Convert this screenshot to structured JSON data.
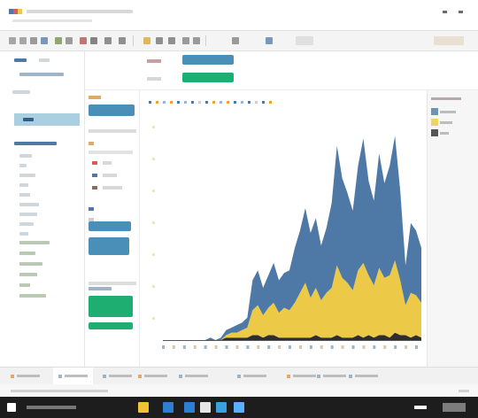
{
  "window": {
    "title": "",
    "accent": "#4e79a7"
  },
  "toolbar": {
    "buttons": [
      {
        "icon": "back-icon",
        "color": "#8c8c8c"
      },
      {
        "icon": "forward-icon",
        "color": "#8c8c8c"
      },
      {
        "icon": "save-icon",
        "color": "#7c7c7c"
      },
      {
        "icon": "new-datasource-icon",
        "color": "#4e79a7"
      },
      {
        "icon": "new-sheet-icon",
        "color": "#6b8e3f"
      },
      {
        "icon": "duplicate-icon",
        "color": "#7f7f7f"
      },
      {
        "icon": "clear-icon",
        "color": "#b04c4c"
      },
      {
        "icon": "swap-icon",
        "color": "#5f5f5f"
      },
      {
        "icon": "sort-asc-icon",
        "color": "#6d6d6d"
      },
      {
        "icon": "sort-desc-icon",
        "color": "#6d6d6d"
      },
      {
        "icon": "highlight-icon",
        "color": "#d8a32b"
      },
      {
        "icon": "group-icon",
        "color": "#6d6d6d"
      },
      {
        "icon": "label-icon",
        "color": "#6d6d6d"
      },
      {
        "icon": "fix-axes-icon",
        "color": "#7b7b7b"
      },
      {
        "icon": "fit-icon",
        "color": "#7b7b7b"
      },
      {
        "icon": "present-icon",
        "color": "#7b7b7b"
      },
      {
        "icon": "share-icon",
        "color": "#4e79a7"
      }
    ]
  },
  "data_pane": {
    "tabs": [
      "",
      ""
    ],
    "datasource": "",
    "dimensions_header": "",
    "dimensions": [
      "",
      "",
      "",
      "",
      "",
      "",
      "",
      "",
      ""
    ],
    "measures_header": "",
    "measures": [
      "",
      "",
      "",
      "",
      "",
      ""
    ]
  },
  "shelves": {
    "columns_label": "",
    "columns_pill": "",
    "rows_label": "",
    "rows_pill": ""
  },
  "cards": {
    "pages_label": "",
    "filters_label": "",
    "filter_pill": "",
    "marks_label": "",
    "marks_type": "",
    "marks_pills": [
      "",
      ""
    ],
    "color_pill": "",
    "size_pill": ""
  },
  "viz": {
    "title": ""
  },
  "legend": {
    "title": "",
    "entries": [
      {
        "label": "",
        "color": "#4e79a7"
      },
      {
        "label": "",
        "color": "#edc948"
      },
      {
        "label": "",
        "color": "#2e2e2e"
      }
    ]
  },
  "chart_data": {
    "type": "area",
    "stacked": true,
    "title": "",
    "xlabel": "",
    "ylabel": "",
    "x_tick_labels": [],
    "y_tick_labels": [],
    "grid": false,
    "legend": "right",
    "series": [
      {
        "color": "#2e2e2e",
        "values": [
          0,
          0,
          0,
          0,
          0,
          0,
          0,
          0,
          0,
          0,
          0,
          0,
          1,
          1,
          1,
          1,
          1,
          2,
          2,
          1,
          2,
          2,
          1,
          1,
          1,
          1,
          1,
          1,
          1,
          2,
          1,
          1,
          1,
          2,
          1,
          1,
          1,
          2,
          1,
          2,
          1,
          2,
          2,
          1,
          3,
          2,
          2,
          1,
          2,
          1
        ]
      },
      {
        "color": "#edc948",
        "values": [
          0,
          0,
          0,
          0,
          0,
          0,
          0,
          0,
          0,
          0,
          0,
          0,
          1,
          2,
          2,
          3,
          4,
          10,
          12,
          9,
          11,
          13,
          10,
          12,
          11,
          14,
          18,
          22,
          16,
          19,
          15,
          18,
          20,
          28,
          24,
          22,
          19,
          26,
          30,
          24,
          21,
          27,
          23,
          25,
          29,
          22,
          12,
          18,
          16,
          14
        ]
      },
      {
        "color": "#4e79a7",
        "values": [
          0,
          0,
          0,
          0,
          0,
          0,
          0,
          0,
          0,
          1,
          0,
          1,
          2,
          2,
          3,
          3,
          4,
          12,
          14,
          11,
          13,
          16,
          13,
          14,
          16,
          22,
          25,
          30,
          26,
          28,
          22,
          26,
          34,
          48,
          40,
          36,
          32,
          42,
          50,
          38,
          34,
          46,
          38,
          44,
          50,
          36,
          16,
          28,
          26,
          22
        ]
      }
    ]
  },
  "sheet_tabs": [
    "",
    "",
    "",
    "",
    "",
    "",
    "",
    "",
    ""
  ],
  "status": {
    "left": "",
    "right": ""
  },
  "taskbar": {
    "apps": [
      {
        "icon": "file-explorer-icon",
        "color": "#f1c232"
      },
      {
        "icon": "browser-icon",
        "color": "#2d7fd3"
      },
      {
        "icon": "mail-icon",
        "color": "#2d7fd3"
      },
      {
        "icon": "tableau-icon",
        "color": "#e6e6e6"
      },
      {
        "icon": "store-icon",
        "color": "#3aa0e0"
      },
      {
        "icon": "app-icon",
        "color": "#5ab0ff"
      }
    ],
    "clock": ""
  }
}
